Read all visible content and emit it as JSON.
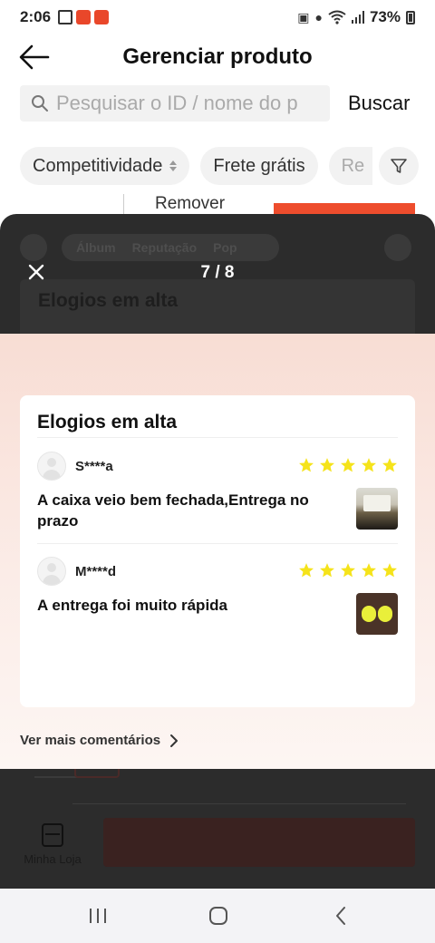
{
  "status_bar": {
    "time": "2:06",
    "battery": "73%"
  },
  "header": {
    "title": "Gerenciar produto"
  },
  "search": {
    "placeholder": "Pesquisar o ID / nome do p",
    "button_label": "Buscar"
  },
  "filters": {
    "chips": [
      "Competitividade",
      "Frete grátis",
      "Re"
    ]
  },
  "background_page": {
    "remove_label": "Remover",
    "my_store_label": "Minha Loja"
  },
  "overlay": {
    "counter": "7 / 8",
    "ghost_tabs": [
      "Álbum",
      "Reputação",
      "Pop"
    ],
    "ghost_title": "Elogios em alta"
  },
  "praise_card": {
    "title": "Elogios em alta",
    "reviews": [
      {
        "reviewer": "S****a",
        "rating": 5,
        "text": "A caixa veio bem fechada,Entrega no prazo"
      },
      {
        "reviewer": "M****d",
        "rating": 5,
        "text": "A entrega foi muito rápida"
      }
    ],
    "more_label": "Ver mais comentários"
  },
  "colors": {
    "brand": "#ee4d2d",
    "star": "#f5e31a",
    "overlay": "#2c2c2c"
  }
}
